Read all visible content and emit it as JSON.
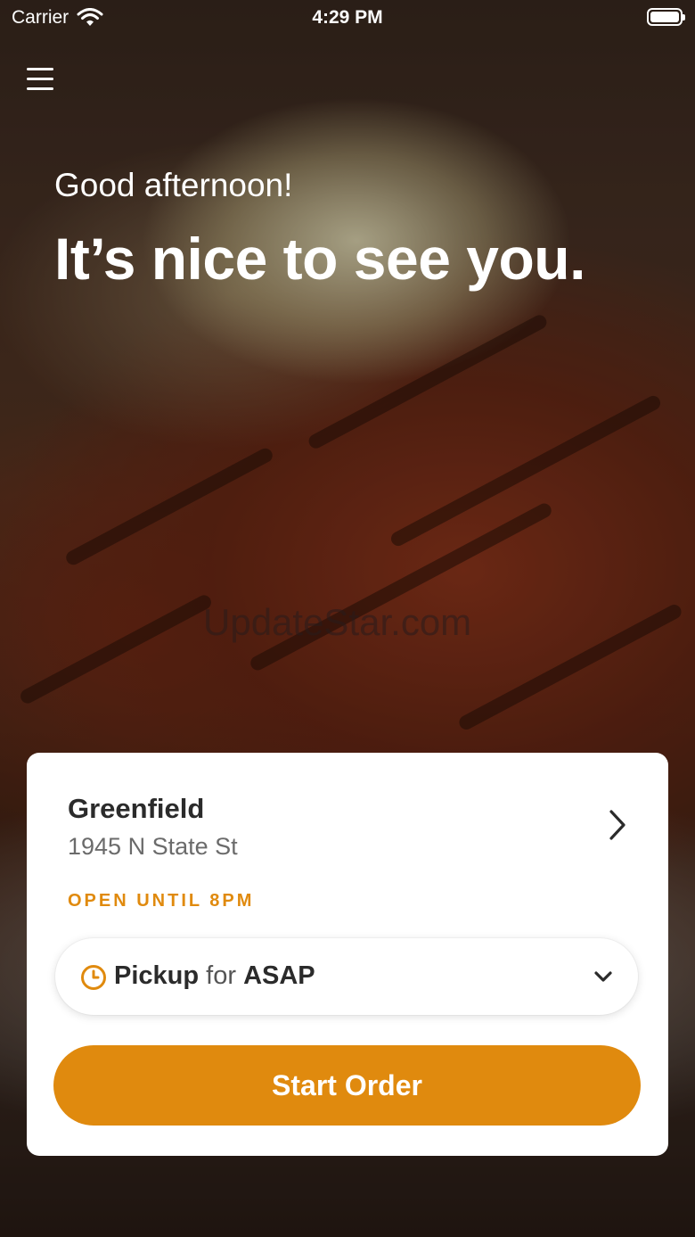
{
  "status_bar": {
    "carrier": "Carrier",
    "time": "4:29 PM",
    "icons": [
      "wifi-icon",
      "battery-icon"
    ]
  },
  "menu": {
    "icon": "hamburger-menu-icon"
  },
  "hero": {
    "greeting": "Good afternoon!",
    "headline": "It’s nice to see you.",
    "watermark": "UpdateStar.com"
  },
  "store": {
    "name": "Greenfield",
    "address": "1945 N State St",
    "hours": "OPEN UNTIL 8PM",
    "icon": "chevron-right-icon"
  },
  "pickup": {
    "mode": "Pickup",
    "connector": "for",
    "time": "ASAP",
    "icons": [
      "clock-icon",
      "chevron-down-icon"
    ]
  },
  "actions": {
    "start_order": "Start Order"
  },
  "colors": {
    "accent": "#e08a0e",
    "card": "#ffffff",
    "text_dark": "#2b2b2b",
    "text_muted": "#6b6b6b"
  }
}
